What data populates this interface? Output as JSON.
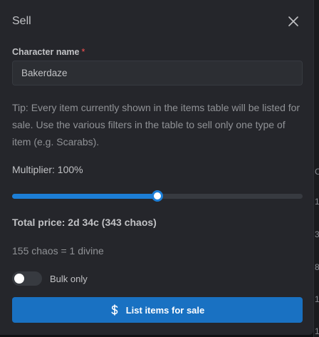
{
  "modal": {
    "title": "Sell",
    "close_icon": "close-icon"
  },
  "form": {
    "character_label": "Character name",
    "required_mark": "*",
    "character_value": "Bakerdaze",
    "tip": "Tip: Every item currently shown in the items table will be listed for sale. Use the various filters in the table to sell only one type of item (e.g. Scarabs).",
    "multiplier_label": "Multiplier: 100%",
    "multiplier_fraction": 0.5,
    "total_price": "Total price: 2d 34c (343 chaos)",
    "exchange_rate": "155 chaos = 1 divine",
    "bulk_label": "Bulk only",
    "bulk_on": false,
    "submit_label": "List items for sale",
    "submit_icon": "dollar-icon"
  },
  "background": {
    "column_glyphs": [
      "C",
      "1",
      "3",
      "8",
      "1",
      "1"
    ]
  },
  "colors": {
    "accent": "#1c7ed6",
    "button": "#1971c2",
    "required": "#fa5252",
    "modal_bg": "#25262b"
  }
}
